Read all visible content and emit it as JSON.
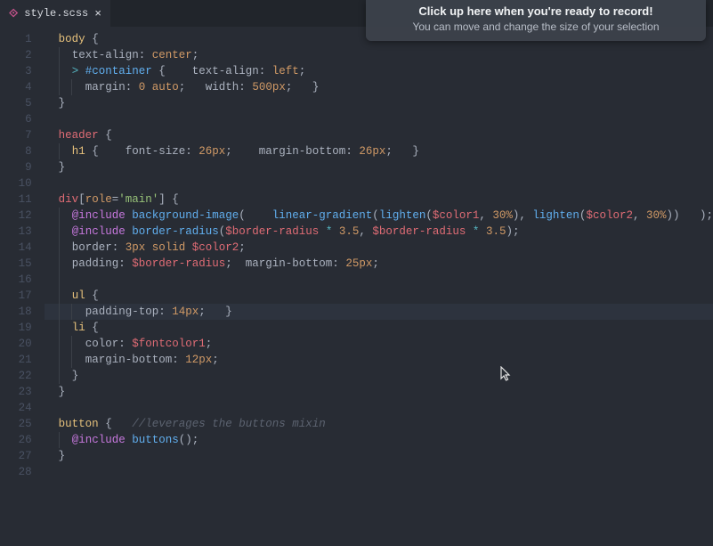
{
  "tab": {
    "icon_glyph": "⟐",
    "filename": "style.scss",
    "close_glyph": "×"
  },
  "overlay": {
    "line1": "Click up here when you're ready to record!",
    "line2": "You can move and change the size of your selection"
  },
  "gutter": {
    "start": 1,
    "end": 28
  },
  "code": {
    "l1": {
      "a": "body",
      "b": " {"
    },
    "l2": {
      "a": "text-align",
      "b": ": ",
      "c": "center",
      "d": ";"
    },
    "l3": {
      "a": ">",
      "b": " ",
      "c": "#container",
      "d": " {    ",
      "e": "text-align",
      "f": ": ",
      "g": "left",
      "h": ";"
    },
    "l4": {
      "a": "margin",
      "b": ": ",
      "c": "0",
      "d": " ",
      "e": "auto",
      "f": ";   ",
      "g": "width",
      "h": ": ",
      "i": "500px",
      "j": ";   }"
    },
    "l5": {
      "a": "}"
    },
    "l7": {
      "a": "header",
      "b": " {"
    },
    "l8": {
      "a": "h1",
      "b": " {    ",
      "c": "font-size",
      "d": ": ",
      "e": "26px",
      "f": ";    ",
      "g": "margin-bottom",
      "h": ": ",
      "i": "26px",
      "j": ";   }"
    },
    "l9": {
      "a": "}"
    },
    "l11": {
      "a": "div",
      "b": "[",
      "c": "role",
      "d": "=",
      "e": "'main'",
      "f": "]",
      "g": " {"
    },
    "l12": {
      "a": "@include",
      "b": " ",
      "c": "background-image",
      "d": "(    ",
      "e": "linear-gradient",
      "f": "(",
      "g": "lighten",
      "h": "(",
      "i": "$color1",
      "j": ", ",
      "k": "30%",
      "l": "), ",
      "m": "lighten",
      "n": "(",
      "o": "$color2",
      "p": ", ",
      "q": "30%",
      "r": "))   );"
    },
    "l13": {
      "a": "@include",
      "b": " ",
      "c": "border-radius",
      "d": "(",
      "e": "$border-radius",
      "f": " ",
      "g": "*",
      "h": " ",
      "i": "3.5",
      "j": ", ",
      "k": "$border-radius",
      "l": " ",
      "m": "*",
      "n": " ",
      "o": "3.5",
      "p": ");"
    },
    "l14": {
      "a": "border",
      "b": ": ",
      "c": "3px",
      "d": " ",
      "e": "solid",
      "f": " ",
      "g": "$color2",
      "h": ";"
    },
    "l15": {
      "a": "padding",
      "b": ": ",
      "c": "$border-radius",
      "d": ";  ",
      "e": "margin-bottom",
      "f": ": ",
      "g": "25px",
      "h": ";"
    },
    "l17": {
      "a": "ul",
      "b": " {"
    },
    "l18": {
      "a": "padding-top",
      "b": ": ",
      "c": "14px",
      "d": ";   }"
    },
    "l19": {
      "a": "li",
      "b": " {"
    },
    "l20": {
      "a": "color",
      "b": ": ",
      "c": "$fontcolor1",
      "d": ";"
    },
    "l21": {
      "a": "margin-bottom",
      "b": ": ",
      "c": "12px",
      "d": ";"
    },
    "l22": {
      "a": "}"
    },
    "l23": {
      "a": "}"
    },
    "l25": {
      "a": "button",
      "b": " {   ",
      "c": "//leverages the buttons mixin"
    },
    "l26": {
      "a": "@include",
      "b": " ",
      "c": "buttons",
      "d": "();"
    },
    "l27": {
      "a": "}"
    }
  }
}
